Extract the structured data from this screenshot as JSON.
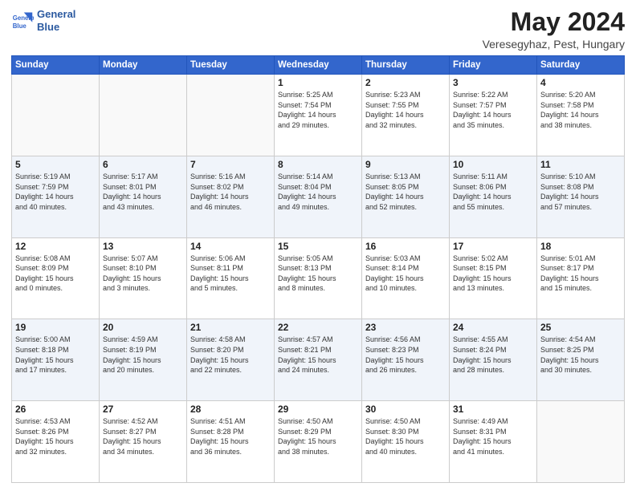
{
  "logo": {
    "line1": "General",
    "line2": "Blue"
  },
  "title": "May 2024",
  "subtitle": "Veresegyhaz, Pest, Hungary",
  "weekdays": [
    "Sunday",
    "Monday",
    "Tuesday",
    "Wednesday",
    "Thursday",
    "Friday",
    "Saturday"
  ],
  "weeks": [
    [
      {
        "day": "",
        "text": ""
      },
      {
        "day": "",
        "text": ""
      },
      {
        "day": "",
        "text": ""
      },
      {
        "day": "1",
        "text": "Sunrise: 5:25 AM\nSunset: 7:54 PM\nDaylight: 14 hours\nand 29 minutes."
      },
      {
        "day": "2",
        "text": "Sunrise: 5:23 AM\nSunset: 7:55 PM\nDaylight: 14 hours\nand 32 minutes."
      },
      {
        "day": "3",
        "text": "Sunrise: 5:22 AM\nSunset: 7:57 PM\nDaylight: 14 hours\nand 35 minutes."
      },
      {
        "day": "4",
        "text": "Sunrise: 5:20 AM\nSunset: 7:58 PM\nDaylight: 14 hours\nand 38 minutes."
      }
    ],
    [
      {
        "day": "5",
        "text": "Sunrise: 5:19 AM\nSunset: 7:59 PM\nDaylight: 14 hours\nand 40 minutes."
      },
      {
        "day": "6",
        "text": "Sunrise: 5:17 AM\nSunset: 8:01 PM\nDaylight: 14 hours\nand 43 minutes."
      },
      {
        "day": "7",
        "text": "Sunrise: 5:16 AM\nSunset: 8:02 PM\nDaylight: 14 hours\nand 46 minutes."
      },
      {
        "day": "8",
        "text": "Sunrise: 5:14 AM\nSunset: 8:04 PM\nDaylight: 14 hours\nand 49 minutes."
      },
      {
        "day": "9",
        "text": "Sunrise: 5:13 AM\nSunset: 8:05 PM\nDaylight: 14 hours\nand 52 minutes."
      },
      {
        "day": "10",
        "text": "Sunrise: 5:11 AM\nSunset: 8:06 PM\nDaylight: 14 hours\nand 55 minutes."
      },
      {
        "day": "11",
        "text": "Sunrise: 5:10 AM\nSunset: 8:08 PM\nDaylight: 14 hours\nand 57 minutes."
      }
    ],
    [
      {
        "day": "12",
        "text": "Sunrise: 5:08 AM\nSunset: 8:09 PM\nDaylight: 15 hours\nand 0 minutes."
      },
      {
        "day": "13",
        "text": "Sunrise: 5:07 AM\nSunset: 8:10 PM\nDaylight: 15 hours\nand 3 minutes."
      },
      {
        "day": "14",
        "text": "Sunrise: 5:06 AM\nSunset: 8:11 PM\nDaylight: 15 hours\nand 5 minutes."
      },
      {
        "day": "15",
        "text": "Sunrise: 5:05 AM\nSunset: 8:13 PM\nDaylight: 15 hours\nand 8 minutes."
      },
      {
        "day": "16",
        "text": "Sunrise: 5:03 AM\nSunset: 8:14 PM\nDaylight: 15 hours\nand 10 minutes."
      },
      {
        "day": "17",
        "text": "Sunrise: 5:02 AM\nSunset: 8:15 PM\nDaylight: 15 hours\nand 13 minutes."
      },
      {
        "day": "18",
        "text": "Sunrise: 5:01 AM\nSunset: 8:17 PM\nDaylight: 15 hours\nand 15 minutes."
      }
    ],
    [
      {
        "day": "19",
        "text": "Sunrise: 5:00 AM\nSunset: 8:18 PM\nDaylight: 15 hours\nand 17 minutes."
      },
      {
        "day": "20",
        "text": "Sunrise: 4:59 AM\nSunset: 8:19 PM\nDaylight: 15 hours\nand 20 minutes."
      },
      {
        "day": "21",
        "text": "Sunrise: 4:58 AM\nSunset: 8:20 PM\nDaylight: 15 hours\nand 22 minutes."
      },
      {
        "day": "22",
        "text": "Sunrise: 4:57 AM\nSunset: 8:21 PM\nDaylight: 15 hours\nand 24 minutes."
      },
      {
        "day": "23",
        "text": "Sunrise: 4:56 AM\nSunset: 8:23 PM\nDaylight: 15 hours\nand 26 minutes."
      },
      {
        "day": "24",
        "text": "Sunrise: 4:55 AM\nSunset: 8:24 PM\nDaylight: 15 hours\nand 28 minutes."
      },
      {
        "day": "25",
        "text": "Sunrise: 4:54 AM\nSunset: 8:25 PM\nDaylight: 15 hours\nand 30 minutes."
      }
    ],
    [
      {
        "day": "26",
        "text": "Sunrise: 4:53 AM\nSunset: 8:26 PM\nDaylight: 15 hours\nand 32 minutes."
      },
      {
        "day": "27",
        "text": "Sunrise: 4:52 AM\nSunset: 8:27 PM\nDaylight: 15 hours\nand 34 minutes."
      },
      {
        "day": "28",
        "text": "Sunrise: 4:51 AM\nSunset: 8:28 PM\nDaylight: 15 hours\nand 36 minutes."
      },
      {
        "day": "29",
        "text": "Sunrise: 4:50 AM\nSunset: 8:29 PM\nDaylight: 15 hours\nand 38 minutes."
      },
      {
        "day": "30",
        "text": "Sunrise: 4:50 AM\nSunset: 8:30 PM\nDaylight: 15 hours\nand 40 minutes."
      },
      {
        "day": "31",
        "text": "Sunrise: 4:49 AM\nSunset: 8:31 PM\nDaylight: 15 hours\nand 41 minutes."
      },
      {
        "day": "",
        "text": ""
      }
    ]
  ]
}
